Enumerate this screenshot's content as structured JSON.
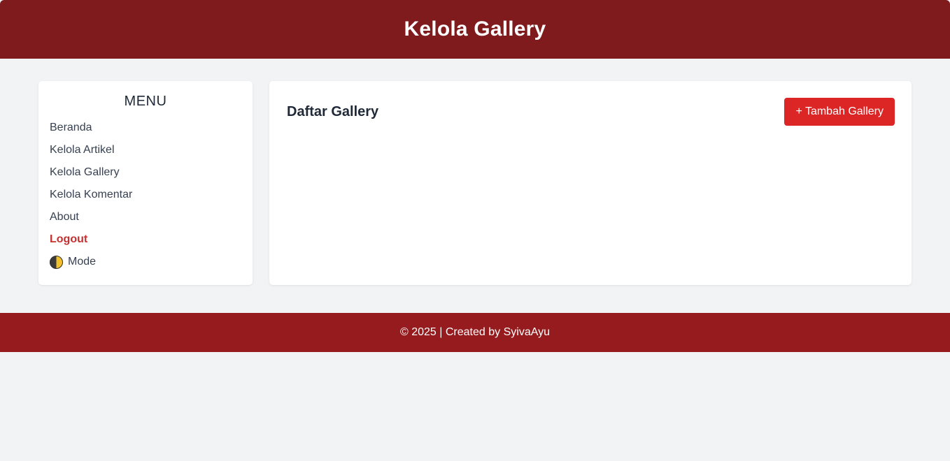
{
  "header": {
    "title": "Kelola Gallery"
  },
  "sidebar": {
    "title": "MENU",
    "items": [
      {
        "label": "Beranda"
      },
      {
        "label": "Kelola Artikel"
      },
      {
        "label": "Kelola Gallery"
      },
      {
        "label": "Kelola Komentar"
      },
      {
        "label": "About"
      },
      {
        "label": "Logout"
      },
      {
        "label": "Mode",
        "icon": "half-moon-mode-icon"
      }
    ]
  },
  "main": {
    "title": "Daftar Gallery",
    "add_button_label": "+ Tambah Gallery"
  },
  "footer": {
    "text": "© 2025 | Created by SyivaAyu"
  },
  "colors": {
    "header_bg": "#7f1b1d",
    "footer_bg": "#961b1e",
    "accent_button": "#dc2626",
    "logout_text": "#c53030",
    "page_bg": "#f2f3f5"
  }
}
